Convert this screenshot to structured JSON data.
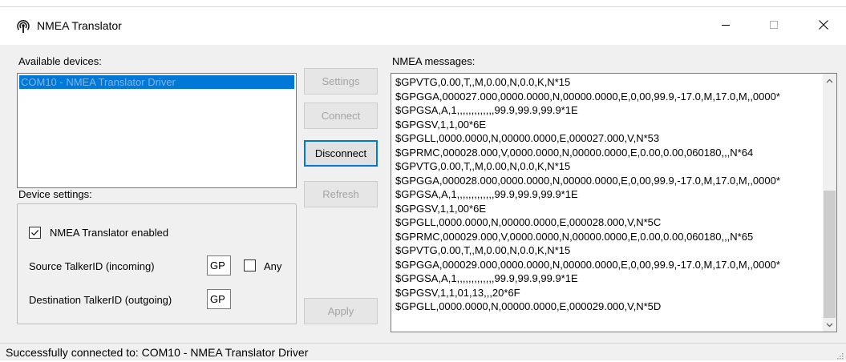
{
  "window": {
    "title": "NMEA Translator",
    "icon": "antenna-signal-icon",
    "controls": [
      "minimize-icon",
      "maximize-icon",
      "close-icon"
    ]
  },
  "devices": {
    "label": "Available devices:",
    "items": [
      "COM10 - NMEA Translator Driver"
    ],
    "selected": "COM10 - NMEA Translator Driver"
  },
  "device_settings": {
    "label": "Device settings:",
    "enabled_label": "NMEA Translator enabled",
    "enabled": true,
    "source_label": "Source TalkerID (incoming)",
    "source_value": "GP",
    "any_label": "Any",
    "any_checked": false,
    "dest_label": "Destination TalkerID (outgoing)",
    "dest_value": "GP"
  },
  "buttons": {
    "settings": "Settings",
    "connect": "Connect",
    "disconnect": "Disconnect",
    "refresh": "Refresh",
    "apply": "Apply"
  },
  "messages": {
    "label": "NMEA messages:",
    "lines": [
      "$GPVTG,0.00,T,,M,0.00,N,0.0,K,N*15",
      "$GPGGA,000027.000,0000.0000,N,00000.0000,E,0,00,99.9,-17.0,M,17.0,M,,0000*",
      "$GPGSA,A,1,,,,,,,,,,,,,99.9,99.9,99.9*1E",
      "$GPGSV,1,1,00*6E",
      "$GPGLL,0000.0000,N,00000.0000,E,000027.000,V,N*53",
      "$GPRMC,000028.000,V,0000.0000,N,00000.0000,E,0.00,0.00,060180,,,N*64",
      "$GPVTG,0.00,T,,M,0.00,N,0.0,K,N*15",
      "$GPGGA,000028.000,0000.0000,N,00000.0000,E,0,00,99.9,-17.0,M,17.0,M,,0000*",
      "$GPGSA,A,1,,,,,,,,,,,,,99.9,99.9,99.9*1E",
      "$GPGSV,1,1,00*6E",
      "$GPGLL,0000.0000,N,00000.0000,E,000028.000,V,N*5C",
      "$GPRMC,000029.000,V,0000.0000,N,00000.0000,E,0.00,0.00,060180,,,N*65",
      "$GPVTG,0.00,T,,M,0.00,N,0.0,K,N*15",
      "$GPGGA,000029.000,0000.0000,N,00000.0000,E,0,00,99.9,-17.0,M,17.0,M,,0000*",
      "$GPGSA,A,1,,,,,,,,,,,,,99.9,99.9,99.9*1E",
      "$GPGSV,1,1,01,13,,,20*6F",
      "$GPGLL,0000.0000,N,00000.0000,E,000029.000,V,N*5D"
    ]
  },
  "status": {
    "text": "Successfully connected to: COM10 - NMEA Translator Driver"
  },
  "colors": {
    "selection": "#0078d7",
    "accent_border": "#0078d7",
    "disabled_text": "#a3a3a3"
  }
}
